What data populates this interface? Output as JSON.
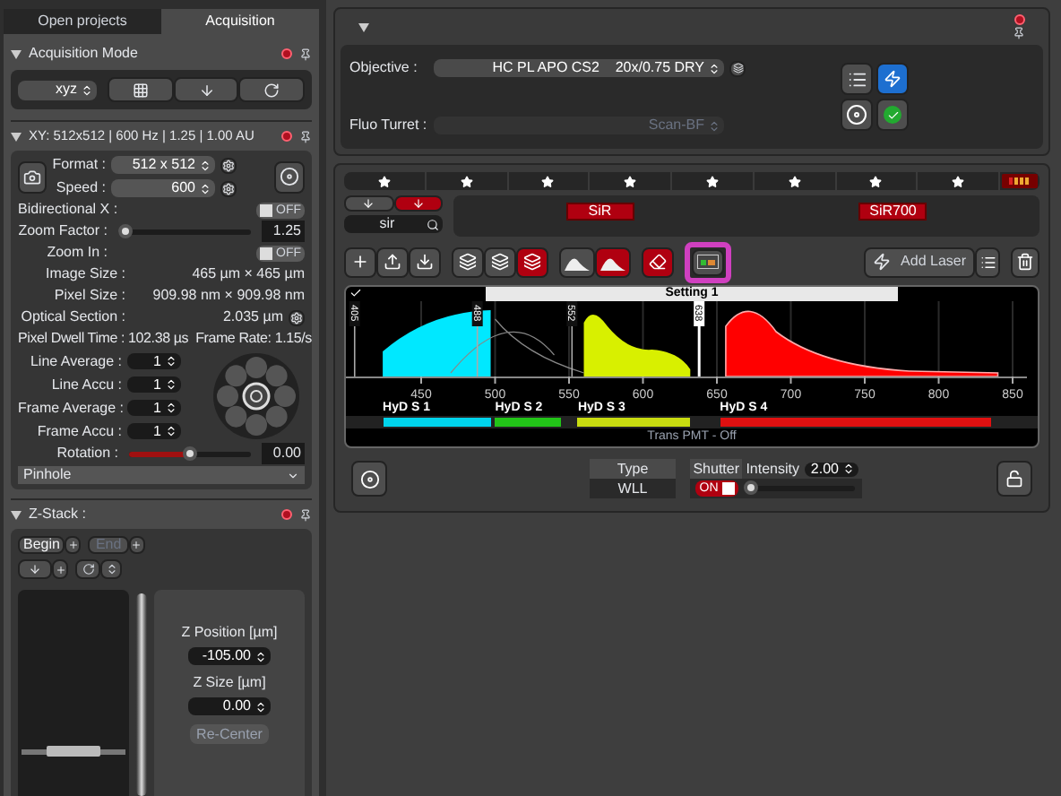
{
  "left_tabs": [
    {
      "label": "Open projects",
      "selected": false
    },
    {
      "label": "Acquisition",
      "selected": true
    }
  ],
  "acquisition_mode": {
    "title": "Acquisition Mode",
    "mode": "xyz"
  },
  "xy": {
    "title": "XY: 512x512 | 600 Hz | 1.25 | 1.00 AU",
    "format": {
      "label": "Format :",
      "value": "512 x 512"
    },
    "speed": {
      "label": "Speed :",
      "value": "600"
    },
    "bidirectional": {
      "label": "Bidirectional X :",
      "text": "OFF",
      "on": false
    },
    "zoom_factor": {
      "label": "Zoom Factor :",
      "value": "1.25",
      "level": 0.05
    },
    "zoom_in": {
      "label": "Zoom In :",
      "text": "OFF",
      "on": false
    },
    "info": [
      {
        "label": "Image Size :",
        "value": "465 µm × 465 µm"
      },
      {
        "label": "Pixel Size :",
        "value": "909.98 nm × 909.98 nm"
      },
      {
        "label": "Optical Section :",
        "value": "2.035 µm"
      }
    ],
    "dwell": "Pixel Dwell Time : 102.38 µs",
    "frame_rate": "Frame Rate: 1.15/s",
    "averages": [
      {
        "label": "Line Average :",
        "value": "1"
      },
      {
        "label": "Line Accu :",
        "value": "1"
      },
      {
        "label": "Frame Average :",
        "value": "1"
      },
      {
        "label": "Frame Accu :",
        "value": "1"
      }
    ],
    "rotation": {
      "label": "Rotation :",
      "value": "0.00",
      "level": 0.5
    },
    "pinhole": "Pinhole"
  },
  "zstack": {
    "title": "Z-Stack :",
    "begin": "Begin",
    "end": "End",
    "z_position": {
      "label": "Z Position [µm]",
      "value": "-105.00"
    },
    "z_size": {
      "label": "Z Size [µm]",
      "value": "0.00"
    },
    "recenter": "Re-Center"
  },
  "microscope": {
    "objective": {
      "label": "Objective :",
      "value": "HC PL APO CS2    20x/0.75 DRY"
    },
    "fluo_turret": {
      "label": "Fluo Turret :",
      "value": "Scan-BF",
      "disabled": true
    }
  },
  "beam_buttons": [
    {
      "selected": false
    },
    {
      "selected": true
    }
  ],
  "search": {
    "value": "sir"
  },
  "dyes": [
    "SiR",
    "SiR700"
  ],
  "view_modes": [
    {
      "selected": false
    },
    {
      "selected": false
    },
    {
      "selected": true
    }
  ],
  "spectrum_modes": [
    {
      "selected": false
    },
    {
      "selected": true
    }
  ],
  "add_laser": "Add Laser",
  "setting": "Setting 1",
  "laser_lines": [
    {
      "label": "405",
      "selected": false
    },
    {
      "label": "488",
      "selected": false
    },
    {
      "label": "552",
      "selected": false
    },
    {
      "label": "638",
      "selected": true
    }
  ],
  "axis_labels": [
    "450",
    "500",
    "550",
    "600",
    "650",
    "700",
    "750",
    "800",
    "850"
  ],
  "detectors": [
    {
      "name": "HyD S 1",
      "color": "#00d4ec"
    },
    {
      "name": "HyD S 2",
      "color": "#22c418"
    },
    {
      "name": "HyD S 3",
      "color": "#c8dc10"
    },
    {
      "name": "HyD S 4",
      "color": "#e01010"
    }
  ],
  "trans": "Trans PMT - Off",
  "laser_table": {
    "type_header": "Type",
    "type": "WLL",
    "shutter_header": "Shutter",
    "shutter": {
      "text": "ON",
      "on": true
    },
    "intensity_label": "Intensity",
    "intensity": "2.00",
    "level": 0
  }
}
